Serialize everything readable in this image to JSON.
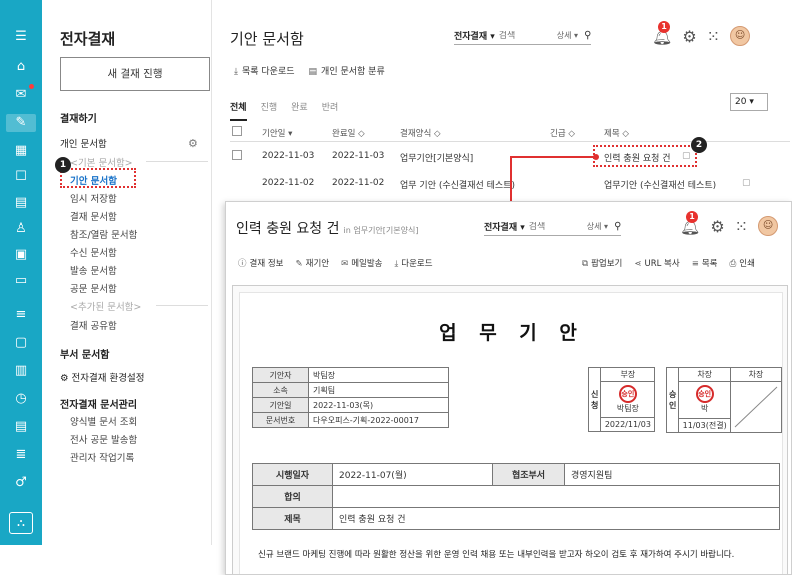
{
  "rail": {
    "icons": [
      "menu-icon",
      "home-icon",
      "mail-icon",
      "approval-icon",
      "board-icon",
      "calendar-small-icon",
      "list-icon",
      "contact-icon",
      "schedule-icon",
      "folder-icon",
      "tasks-icon",
      "chat-icon",
      "report-icon",
      "clock-icon",
      "docs-icon",
      "stack-icon",
      "settings-icon"
    ],
    "org_label": "org-chart"
  },
  "sidebar": {
    "title": "전자결재",
    "new_button": "새 결재 진행",
    "section_do": "결재하기",
    "section_personal": "개인 문서함",
    "group_basic": "<기본 문서함>",
    "items_basic": [
      "기안 문서함",
      "임시 저장함",
      "결재 문서함",
      "참조/열람 문서함",
      "수신 문서함",
      "발송 문서함",
      "공문 문서함"
    ],
    "group_added": "<추가된 문서함>",
    "items_added": [
      "결재 공유함"
    ],
    "section_dept": "부서 문서함",
    "env_settings": "전자결재 환경설정",
    "section_admin": "전자결재 문서관리",
    "items_admin": [
      "양식별 문서 조회",
      "전사 공문 발송함",
      "관리자 작업기록"
    ],
    "step1": "1"
  },
  "main": {
    "title": "기안 문서함",
    "search": {
      "type": "전자결재 ▾",
      "placeholder": "검색",
      "detail": "상세 ▾"
    },
    "notif_count": "1",
    "toolbar": {
      "download": "목록 다운로드",
      "classify": "개인 문서함 분류"
    },
    "tabs": [
      "전체",
      "진행",
      "완료",
      "반려"
    ],
    "page_size": "20 ▾",
    "columns": {
      "draft_date": "기안일 ▾",
      "done_date": "완료일 ◇",
      "form": "결재양식 ◇",
      "urgent": "긴급 ◇",
      "subject": "제목 ◇"
    },
    "rows": [
      {
        "draft_date": "2022-11-03",
        "done_date": "2022-11-03",
        "form": "업무기안[기본양식]",
        "subject": "인력 충원 요청 건"
      },
      {
        "draft_date": "2022-11-02",
        "done_date": "2022-11-02",
        "form": "업무 기안 (수신결재선 테스트)",
        "subject": "업무기안 (수신결재선 테스트)"
      }
    ],
    "step2": "2"
  },
  "popup": {
    "title": "인력 충원 요청 건",
    "form_name": "in 업무기안[기본양식]",
    "search": {
      "type": "전자결재 ▾",
      "placeholder": "검색",
      "detail": "상세 ▾"
    },
    "notif_count": "1",
    "toolbar_left": [
      "결재 정보",
      "재기안",
      "메일발송",
      "다운로드"
    ],
    "toolbar_right": [
      "팝업보기",
      "URL 복사",
      "목록",
      "인쇄"
    ],
    "doc": {
      "heading": "업 무 기 안",
      "info": [
        {
          "label": "기안자",
          "value": "박팀장"
        },
        {
          "label": "소속",
          "value": "기획팀"
        },
        {
          "label": "기안일",
          "value": "2022-11-03(목)"
        },
        {
          "label": "문서번호",
          "value": "다우오피스-기획-2022-00017"
        }
      ],
      "apply": {
        "side_label": "신\n청",
        "role": "부장",
        "stamp": "승인",
        "name": "박팀장",
        "date": "2022/11/03"
      },
      "approve": {
        "side_label": "승\n인",
        "roles": [
          "차장",
          "차장"
        ],
        "stamp": "승인",
        "name": "박",
        "date": "11/03(전결)"
      },
      "exec_label": "시행일자",
      "exec_value": "2022-11-07(월)",
      "coop_label": "협조부서",
      "coop_value": "경영지원팀",
      "agree_label": "합의",
      "subject_label": "제목",
      "subject_value": "인력 충원 요청 건",
      "body": "신규 브랜드 마케팅 진행에 따라 원활한 정산을 위한 운영 인력 채용 또는 내부인력을 받고자 하오이 검토 후 재가하여 주시기 바랍니다."
    }
  }
}
